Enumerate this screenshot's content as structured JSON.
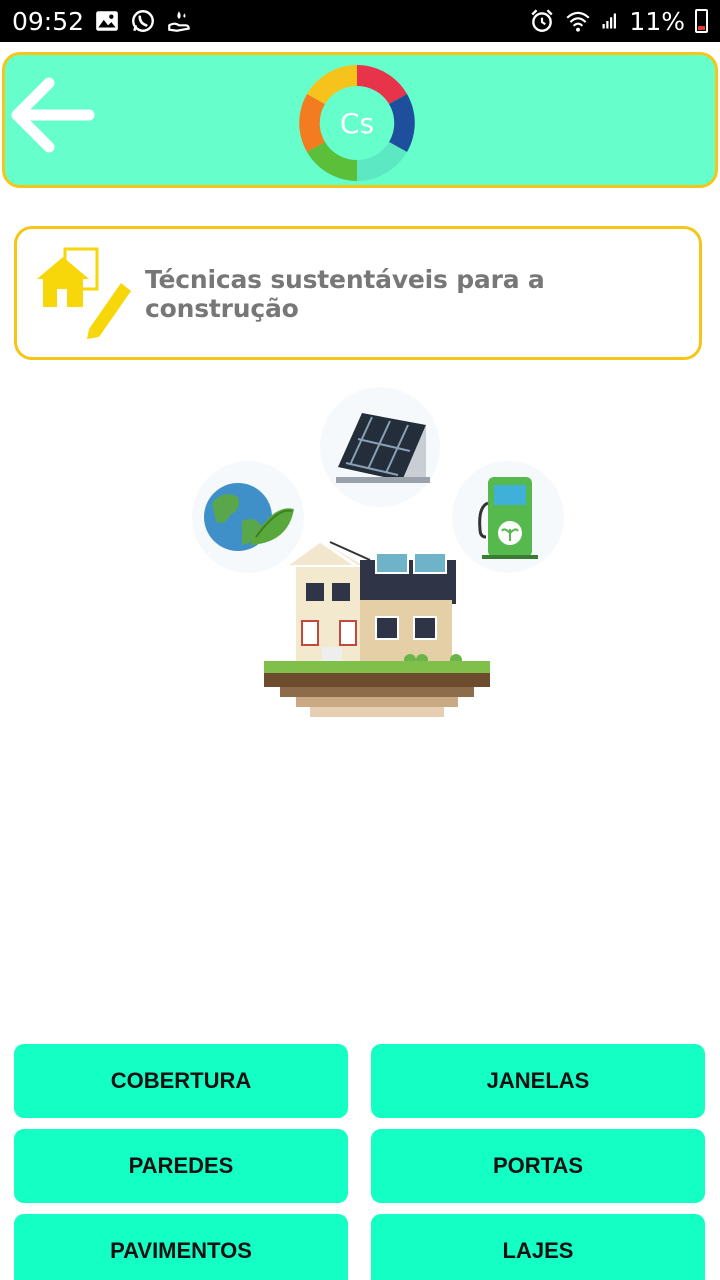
{
  "status_bar": {
    "time": "09:52",
    "battery": "11%",
    "left_icons": [
      "image-icon",
      "whatsapp-icon",
      "hand-water-icon"
    ],
    "right_icons": [
      "alarm-icon",
      "wifi-icon",
      "signal-icon",
      "battery-icon"
    ]
  },
  "app_bar": {
    "back_icon": "arrow-left-icon",
    "logo_text": "Cs"
  },
  "title_card": {
    "icon": "house-pencil-icon",
    "title": "Técnicas sustentáveis para a construção"
  },
  "buttons": [
    {
      "label": "COBERTURA"
    },
    {
      "label": "JANELAS"
    },
    {
      "label": "PAREDES"
    },
    {
      "label": "PORTAS"
    },
    {
      "label": "PAVIMENTOS"
    },
    {
      "label": "LAJES"
    }
  ],
  "colors": {
    "appbar_bg": "#66ffcc",
    "border_accent": "#f5c518",
    "button_bg": "#14ffc4",
    "title_text": "#777777"
  }
}
